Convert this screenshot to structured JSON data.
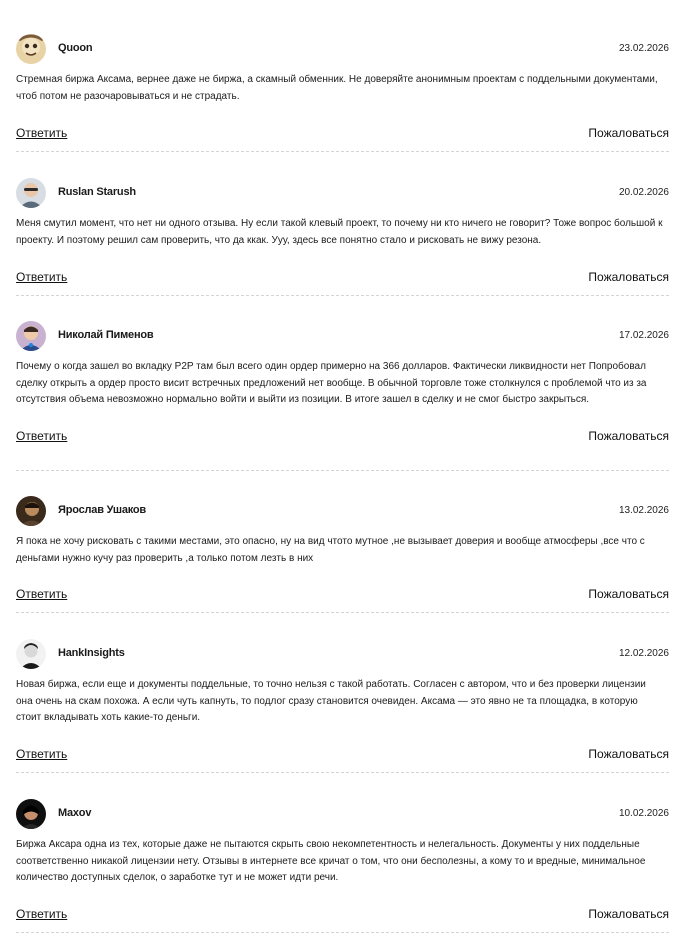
{
  "comments": [
    {
      "author": "Quoon",
      "date": "23.02.2026",
      "text": "Стремная биржа Аксама, вернее даже не биржа, а скамный обменник. Не доверяйте анонимным проектам с поддельными документами, чтоб потом не разочаровываться и не страдать.",
      "reply_label": "Ответить",
      "report_label": "Пожаловаться"
    },
    {
      "author": "Ruslan Starush",
      "date": "20.02.2026",
      "text": "Меня смутил момент, что нет ни одного отзыва. Ну если такой клевый проект, то почему ни кто ничего не говорит? Тоже вопрос большой к проекту. И поэтому решил сам проверить, что да ккак. Ууу, здесь все понятно стало и рисковать не вижу резона.",
      "reply_label": "Ответить",
      "report_label": "Пожаловаться"
    },
    {
      "author": "Николай Пименов",
      "date": "17.02.2026",
      "text": "Почему о когда зашел во вкладку P2P там был всего один ордер примерно на 366 долларов. Фактически ликвидности нет Попробовал сделку открыть а ордер просто висит встречных предложений нет вообще. В обычной торговле тоже столкнулся с проблемой что из за отсутствия объема невозможно нормально войти и выйти из позиции. В итоге зашел в сделку и не смог быстро закрыться.",
      "reply_label": "Ответить",
      "report_label": "Пожаловаться"
    },
    {
      "author": "Ярослав Ушаков",
      "date": "13.02.2026",
      "text": "Я пока не хочу рисковать с такими местами, это опасно, ну на вид чтото мутное ,не вызывает доверия и вообще атмосферы ,все что с деньгами нужно кучу раз проверить ,а только потом лезть в них",
      "reply_label": "Ответить",
      "report_label": "Пожаловаться"
    },
    {
      "author": "HankInsights",
      "date": "12.02.2026",
      "text": "Новая биржа, если еще и документы поддельные, то точно нельзя с такой работать. Согласен с автором, что и без проверки лицензии она очень на скам похожа. А если чуть капнуть, то подлог сразу становится очевиден. Аксама — это явно не та площадка, в которую стоит вкладывать хоть какие-то деньги.",
      "reply_label": "Ответить",
      "report_label": "Пожаловаться"
    },
    {
      "author": "Maxov",
      "date": "10.02.2026",
      "text": "Биржа Аксара одна из тех, которые даже не пытаются скрыть свою некомпетентность и нелегальность. Документы у них поддельные соответственно никакой лицензии нету. Отзывы в интернете все кричат о том, что они бесполезны, а кому то и вредные, минимальное количество доступных сделок, о заработке тут и не может идти речи.",
      "reply_label": "Ответить",
      "report_label": "Пожаловаться"
    }
  ]
}
